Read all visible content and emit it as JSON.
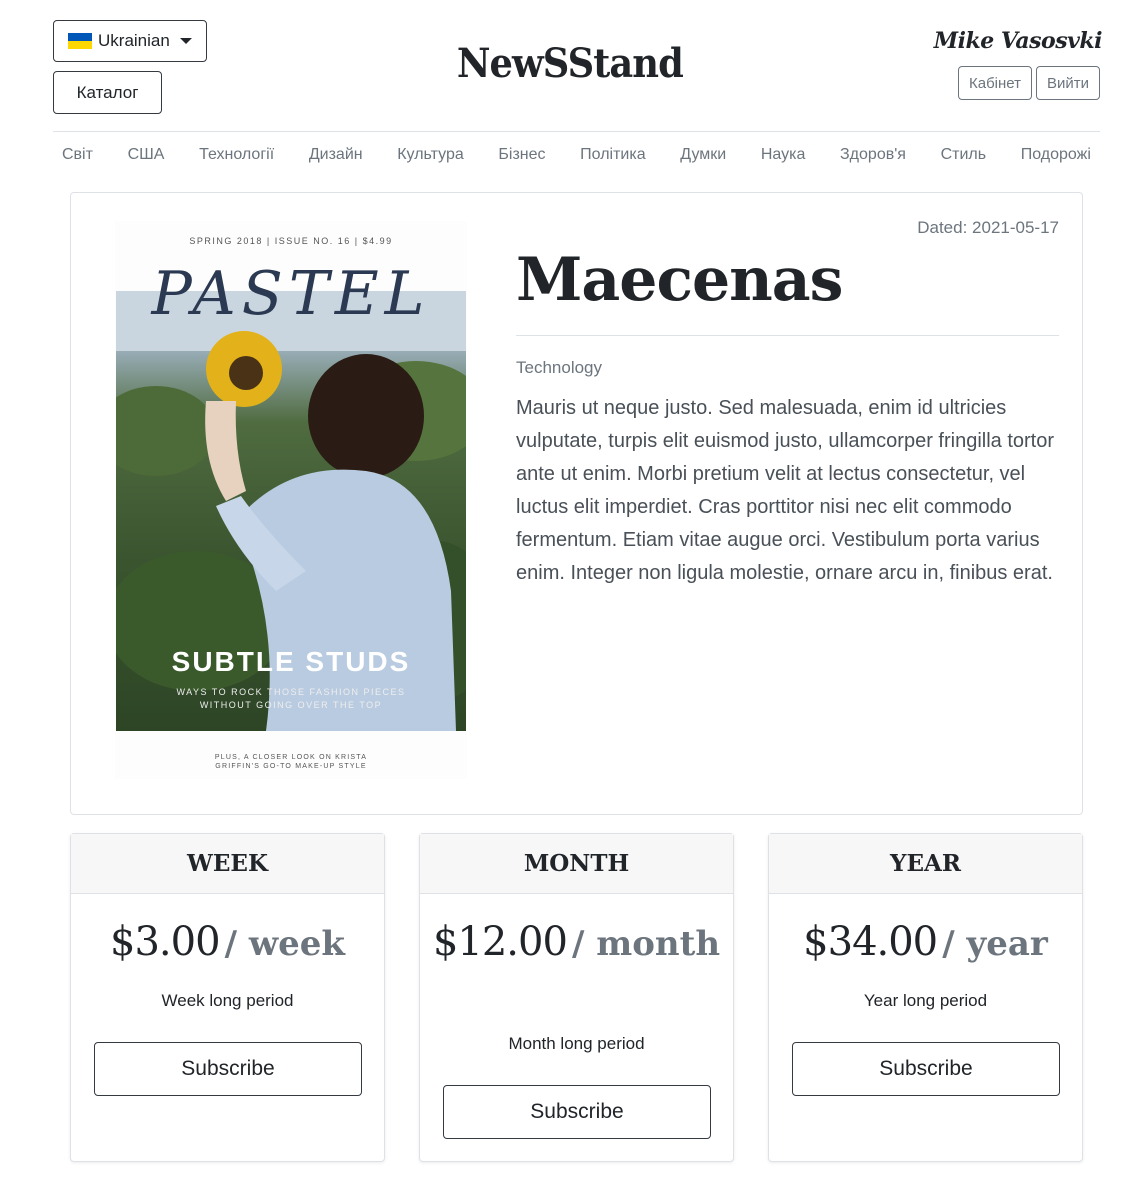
{
  "header": {
    "language": "Ukrainian",
    "catalog_label": "Каталог",
    "brand": "NewSStand",
    "username": "Mike Vasosvki",
    "cabinet_label": "Кабінет",
    "logout_label": "Вийти",
    "flag_colors": {
      "top": "#0057b7",
      "bottom": "#ffd700"
    }
  },
  "nav": {
    "items": [
      "Світ",
      "США",
      "Технології",
      "Дизайн",
      "Культура",
      "Бізнес",
      "Політика",
      "Думки",
      "Наука",
      "Здоров'я",
      "Стиль",
      "Подорожі"
    ]
  },
  "article": {
    "dated": "Dated: 2021-05-17",
    "title": "Maecenas",
    "category": "Technology",
    "body": "Mauris ut neque justo. Sed malesuada, enim id ultricies vulputate, turpis elit euismod justo, ullamcorper fringilla tortor ante ut enim. Morbi pretium velit at lectus consectetur, vel luctus elit imperdiet. Cras porttitor nisi nec elit commodo fermentum. Etiam vitae augue orci. Vestibulum porta varius enim. Integer non ligula molestie, ornare arcu in, finibus erat.",
    "cover": {
      "issue_line": "SPRING 2018 | ISSUE NO. 16 | $4.99",
      "magazine_title": "PASTEL",
      "headline": "SUBTLE STUDS",
      "tagline": "WAYS TO ROCK THOSE FASHION PIECES WITHOUT GOING OVER THE TOP",
      "footer_note": "PLUS, A CLOSER LOOK ON KRISTA GRIFFIN'S GO-TO MAKE-UP STYLE"
    }
  },
  "plans": [
    {
      "name": "WEEK",
      "price": "$3.00",
      "per": "/ week",
      "description": "Week long period",
      "button": "Subscribe"
    },
    {
      "name": "MONTH",
      "price": "$12.00",
      "per": "/ month",
      "description": "Month long period",
      "button": "Subscribe"
    },
    {
      "name": "YEAR",
      "price": "$34.00",
      "per": "/ year",
      "description": "Year long period",
      "button": "Subscribe"
    }
  ]
}
